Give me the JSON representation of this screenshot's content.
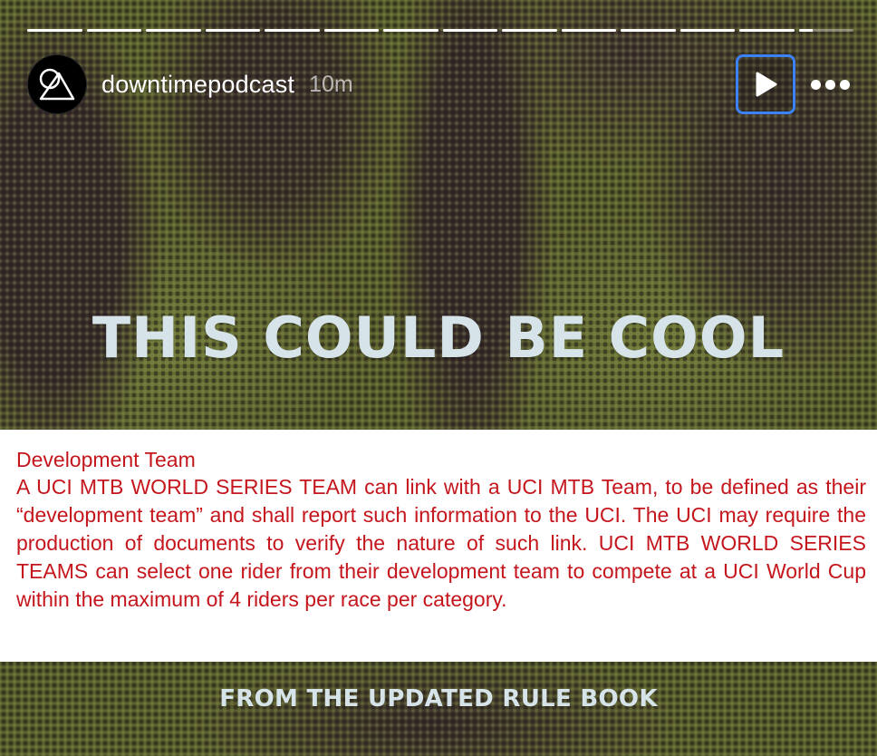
{
  "progress": {
    "segment_count": 14,
    "current_index": 13,
    "current_fraction": 0.25
  },
  "header": {
    "username": "downtimepodcast",
    "time_ago": "10m",
    "avatar_icon": "downtime-logo-icon",
    "play_icon": "play-icon",
    "more_icon": "more-dots-icon"
  },
  "story": {
    "headline": "THIS COULD BE COOL",
    "rule_title": "Development Team",
    "rule_text": "A UCI MTB WORLD SERIES TEAM can link with a UCI MTB Team, to be defined as their “development team” and shall report such information to the UCI. The UCI may require the production of documents to verify the nature of such link. UCI MTB WORLD SERIES TEAMS can select one rider from their development team to compete at a UCI World Cup within the maximum of 4 riders per race per category.",
    "footer": "FROM THE UPDATED RULE BOOK"
  },
  "colors": {
    "accent_focus": "#3b82f6",
    "rule_text": "#c4161c",
    "headline": "#d6e4ea"
  }
}
